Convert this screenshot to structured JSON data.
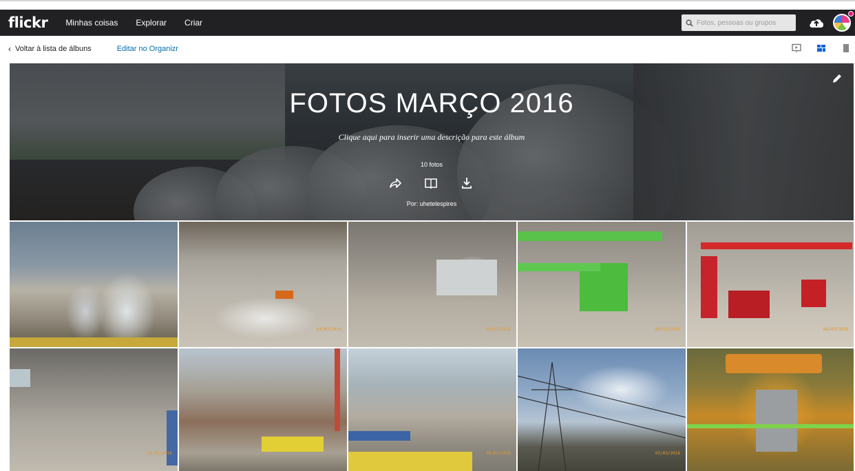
{
  "header": {
    "logo": "flickr",
    "nav": [
      "Minhas coisas",
      "Explorar",
      "Criar"
    ],
    "search_placeholder": "Fotos, pessoas ou grupos"
  },
  "subbar": {
    "back_label": "Voltar à lista de álbuns",
    "edit_label": "Editar no Organizr"
  },
  "album": {
    "title": "FOTOS MARÇO 2016",
    "description": "Clique aqui para inserir uma descrição para este álbum",
    "count": "10 fotos",
    "owner": "Por: uhetelespires"
  },
  "photos": [
    {
      "name": "photo-1",
      "stamp": ""
    },
    {
      "name": "photo-2",
      "stamp": "04/03/2016"
    },
    {
      "name": "photo-3",
      "stamp": "04/03/2016"
    },
    {
      "name": "photo-4",
      "stamp": "04/03/2016"
    },
    {
      "name": "photo-5",
      "stamp": "04/03/2016"
    },
    {
      "name": "photo-6",
      "stamp": "04/03/2016"
    },
    {
      "name": "photo-7",
      "stamp": ""
    },
    {
      "name": "photo-8",
      "stamp": "04/03/2016"
    },
    {
      "name": "photo-9",
      "stamp": "03/03/2016"
    },
    {
      "name": "photo-10",
      "stamp": ""
    }
  ],
  "colors": {
    "navbar": "#212124",
    "link": "#006dac",
    "active_view": "#0063dc"
  }
}
